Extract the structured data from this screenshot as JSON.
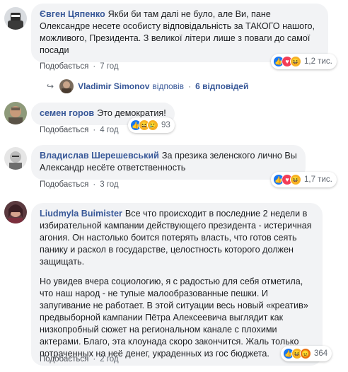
{
  "comments": [
    {
      "author": "Євген Цяпенко",
      "text": "Якби би там далі не було, але Ви, пане Олександре несете особисту відповідальність за ТАКОГО нашого, можливого, Президента. З великої літери лише з поваги до самої посади",
      "like_label": "Подобається",
      "time": "7 год",
      "reaction_count": "1,2 тис.",
      "reactions": [
        "like",
        "love",
        "haha"
      ]
    },
    {
      "author": "семен горов",
      "text": "Это демократия!",
      "like_label": "Подобається",
      "time": "4 год",
      "reaction_count": "93",
      "reactions": [
        "like",
        "haha",
        "sad"
      ]
    },
    {
      "author": "Владислав Шерешевський",
      "text": "За презика зеленского лично Вы Александр несёте ответственность",
      "like_label": "Подобається",
      "time": "3 год",
      "reaction_count": "1,7 тис.",
      "reactions": [
        "like",
        "love",
        "haha"
      ]
    },
    {
      "author": "Liudmyla Buimister",
      "text": "Все что происходит в последние 2 недели в избирательной кампании действующего президента - истеричная агония. Он настолько боится потерять власть, что готов сеять панику и раскол в государстве, целостность которого должен защищать.",
      "text2": "Но увидев вчера социологию, я с радостью для себя отметила, что наш народ - не тупые малообразованные пешки. И запугивание не работает. В этой ситуации весь новый «креатив» предвыборной кампании Пётра Алексеевича выглядит как низкопробный сюжет на региональном канале с плохими актерами. Благо, эта клоунада скоро закончится. Жаль только потраченных на неё денег, украденных из гос бюджета.",
      "like_label": "Подобається",
      "time": "2 год",
      "reaction_count": "364",
      "reactions": [
        "like",
        "haha",
        "angry"
      ]
    }
  ],
  "replies_row": {
    "name": "Vladimir Simonov",
    "replied": "відповів",
    "count": "6 відповідей"
  },
  "separator": "·",
  "colors": {
    "author": "#385898",
    "bubble": "#f2f3f5",
    "like": "#1877f2",
    "love": "#f33e58",
    "haha": "#f7b125",
    "angry": "#e9710f"
  }
}
